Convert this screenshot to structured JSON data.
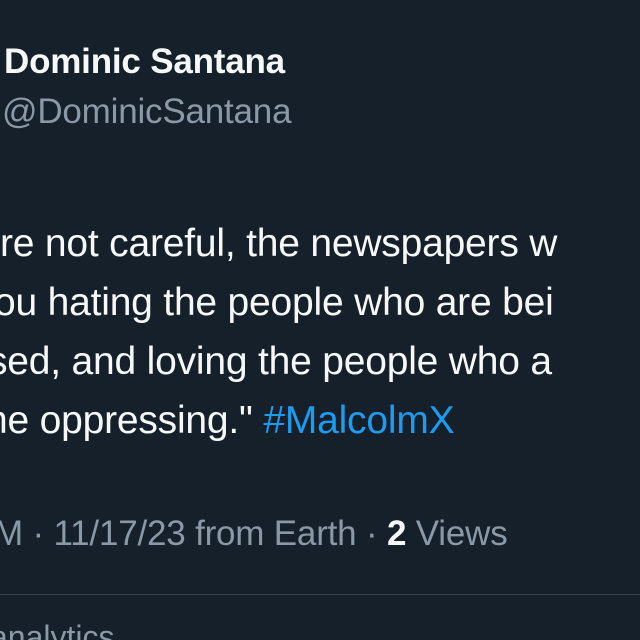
{
  "tweet": {
    "author": {
      "display_name": "Dominic Santana",
      "handle": "@DominicSantana"
    },
    "text_lines": [
      "re not careful, the newspapers w",
      "ou hating the people who are bei",
      "sed, and loving the people who a",
      "he oppressing.\""
    ],
    "hashtag": "#MalcolmX",
    "meta": {
      "time_fragment": "M",
      "separator": " · ",
      "date": "11/17/23",
      "source": "from Earth",
      "views_count": "2",
      "views_label": "Views"
    },
    "analytics_label": "analytics"
  },
  "colors": {
    "background": "#15202b",
    "primary_text": "#f7f9f9",
    "secondary_text": "#8b98a5",
    "hashtag": "#1d9bf0",
    "divider": "#38444d"
  }
}
